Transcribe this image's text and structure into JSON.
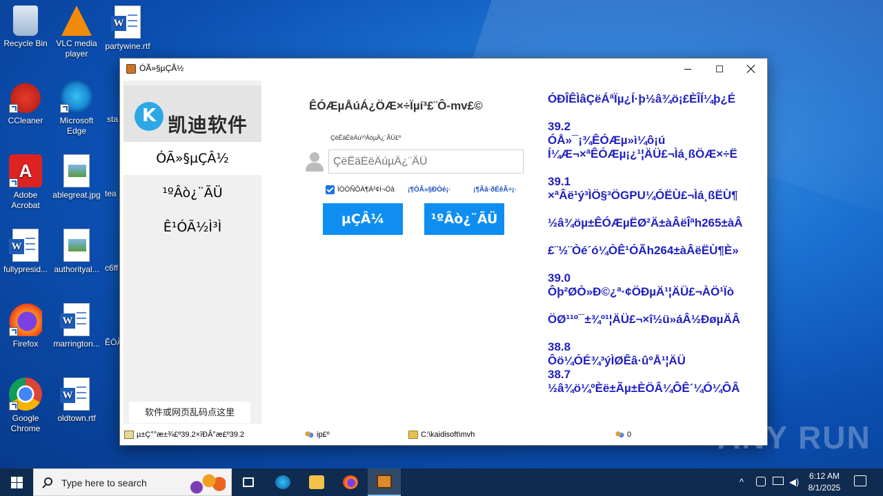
{
  "desktop": {
    "icons": [
      {
        "label": "Recycle Bin"
      },
      {
        "label": "VLC media player"
      },
      {
        "label": "partywine.rtf"
      },
      {
        "label": "CCleaner"
      },
      {
        "label": "Microsoft Edge"
      },
      {
        "label": "sta"
      },
      {
        "label": "Adobe Acrobat"
      },
      {
        "label": "ablegreat.jpg"
      },
      {
        "label": "tea"
      },
      {
        "label": "fullypresid..."
      },
      {
        "label": "authorityal..."
      },
      {
        "label": "c6ff"
      },
      {
        "label": "Firefox"
      },
      {
        "label": "marrington..."
      },
      {
        "label": "ÊÓÃ"
      },
      {
        "label": "Google Chrome"
      },
      {
        "label": "oldtown.rtf"
      }
    ]
  },
  "window": {
    "title": "ÓÃ»§µÇÂ½",
    "logo_text": "凯迪软件",
    "nav": [
      {
        "label": "ÓÃ»§µÇÂ½"
      },
      {
        "label": "¹ºÂò¿¨ÃÜ"
      },
      {
        "label": "Ê¹ÓÃ½Ì³Ì"
      }
    ],
    "garble_help": "软件或网页乱码点这里",
    "main_title": "ÊÓÆµÅúÁ¿ÖÆ×÷Ïµí³£¨Ô-mv£©",
    "form_label": "ÇëÊäÈëÄú¹ºÂòµÄ¿¨ÃÜ£º",
    "input_placeholder": "ÇëÊäÈëÄúµÄ¿¨ÃÜ",
    "remember_label": "ÏÒÒÑÔÄ¶Á²¢Í¬Òâ",
    "link_agreement": "¡¶ÓÃ»§Ð­Òé¡·",
    "link_disclaimer": "¡¶Ãâ·ðÉêÃ÷¡·",
    "login_button": "µÇÂ¼",
    "buy_button": "¹ºÂò¿¨ÃÜ",
    "news": [
      "ÓÐÎÊÌâÇëÁªÏµ¿Í·þ½â¾ö¡£ÈÎÍ¼þ¿É",
      "",
      "39.2",
      "ÓÅ»¯¡¾ÊÓÆµ»ì¼ô¡ú",
      "Í¼Æ¬×ªÊÓÆµ¡¿¹¦ÄÜ£¬Ìá¸ßÖÆ×÷Ë",
      "",
      "39.1",
      "×ªÂë¹ý³ÌÖ§³ÖGPU¼ÓËÙ£¬Ìá¸ßËÙ¶",
      "",
      "½â¾öµ±ÊÓÆµËØ²Ä±àÂëÎªh265±àÂ",
      "",
      "£¨½¨Òé´ó¼ÒÊ¹ÓÃh264±àÂëËÙ¶È»",
      "",
      "39.0",
      "Ôþ²ØÒ»Ð©¿ª·¢ÖÐµÄ¹¦ÄÜ£¬ÀÖ¹Ïò",
      "",
      "ÖØ¹¹º¯±¾º¹¦ÄÜ£¬×î½ü»áÂ½ÐøµÄÂ",
      "",
      "38.8",
      "Ôö¼ÓÉ¾³ýÌØÊâ·ûºÅ¹¦ÄÜ",
      "38.7",
      "½â¾ö¼ºÈë±Ãµ±ÈÖÂ¼ÔÊ´¼Ó¼ÔÂ"
    ],
    "status": {
      "version": "µ±Ç°°æ±¾£º39.2×îÐÂ°æ£º39.2",
      "ip": "ip£º",
      "path": "C:\\kaidisoft\\mvh",
      "users": "0"
    }
  },
  "watermark": "ANY RUN",
  "taskbar": {
    "search_placeholder": "Type here to search",
    "time": "6:12 AM",
    "date": "8/1/2025"
  },
  "colors": {
    "accent": "#0e8ef1",
    "news_text": "#1f1fc0",
    "taskbar": "#0f2b4f"
  }
}
